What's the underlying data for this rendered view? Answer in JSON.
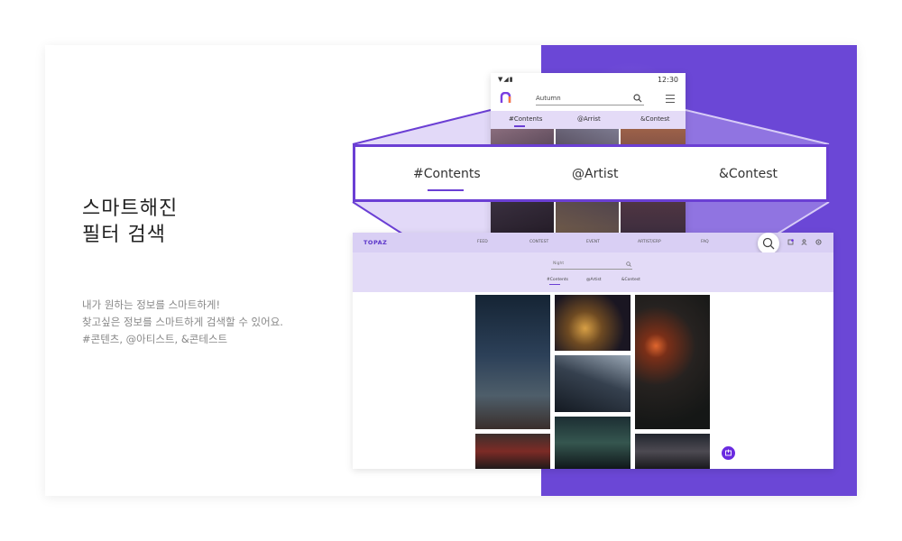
{
  "headline": {
    "line1": "스마트해진",
    "line2": "필터 검색"
  },
  "description": {
    "line1": "내가 원하는 정보를 스마트하게!",
    "line2": "찾고싶은 정보를 스마트하게 검색할 수 있어요.",
    "line3": "#콘텐츠, @아티스트, &콘테스트"
  },
  "phone": {
    "time": "12:30",
    "search_value": "Autumn",
    "tabs": [
      "#Contents",
      "@Arrist",
      "&Contest"
    ]
  },
  "zoom_tabs": [
    "#Contents",
    "@Artist",
    "&Contest"
  ],
  "desktop": {
    "logo": "TOPAZ",
    "nav": [
      "FEED",
      "CONTEST",
      "EVENT",
      "ARTIST/ERP",
      "FAQ"
    ],
    "search_value": "Night",
    "tabs": [
      "#Contents",
      "@Artist",
      "&Contest"
    ]
  },
  "colors": {
    "purple_panel": "#6b47d6",
    "accent": "#6b3fd4",
    "tab_band": "#e4dbf7"
  },
  "icons": [
    "wifi-icon",
    "signal-icon",
    "battery-icon",
    "logo-icon",
    "search-icon",
    "menu-icon",
    "notification-icon",
    "user-icon",
    "settings-icon",
    "upload-icon"
  ]
}
